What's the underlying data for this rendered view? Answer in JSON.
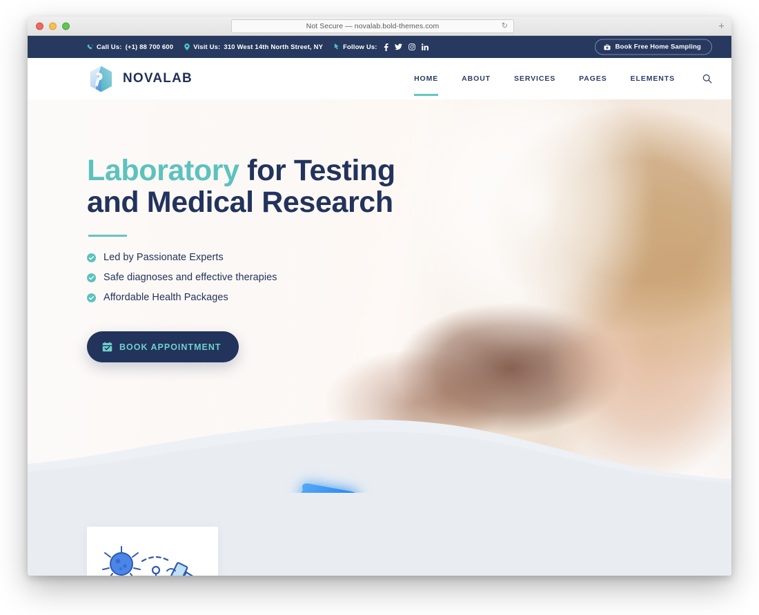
{
  "browser": {
    "url_text": "Not Secure — novalab.bold-themes.com",
    "reload_glyph": "↻",
    "newtab_glyph": "+"
  },
  "topbar": {
    "call_label": "Call Us:",
    "call_value": "(+1) 88 700 600",
    "visit_label": "Visit Us:",
    "visit_value": "310 West 14th North Street, NY",
    "follow_label": "Follow Us:",
    "socials": [
      "facebook-icon",
      "twitter-icon",
      "instagram-icon",
      "linkedin-icon"
    ],
    "cta_label": "Book Free Home Sampling",
    "cta_icon": "medical-kit-icon",
    "bg_color": "#27395f",
    "accent_color": "#4ec3c8"
  },
  "header": {
    "logo_text": "NOVALAB",
    "logo_icon": "hexagon-logo-icon",
    "nav": [
      {
        "label": "HOME",
        "active": true
      },
      {
        "label": "ABOUT",
        "active": false
      },
      {
        "label": "SERVICES",
        "active": false
      },
      {
        "label": "PAGES",
        "active": false
      },
      {
        "label": "ELEMENTS",
        "active": false
      }
    ],
    "search_icon": "search-icon",
    "active_underline_color": "#64c6bd",
    "text_color": "#2a3c63"
  },
  "hero": {
    "title_accent": "Laboratory",
    "title_rest": " for Testing",
    "title_line2": "and Medical Research",
    "accent_color": "#5cc2bd",
    "title_color": "#22335c",
    "bullets": [
      "Led by Passionate Experts",
      "Safe diagnoses and effective therapies",
      "Affordable Health Packages"
    ],
    "bullet_icon": "check-circle-icon",
    "cta_label": "BOOK APPOINTMENT",
    "cta_icon": "calendar-check-icon",
    "cta_bg": "#22335c",
    "cta_text_color": "#6fd0cb",
    "decoration_icon": "blue-triangle-decoration",
    "photo_alt": "scientist-looking-through-microscope"
  },
  "below_section": {
    "bg_color": "#e9edf2",
    "card_icon": "virus-research-illustration"
  }
}
